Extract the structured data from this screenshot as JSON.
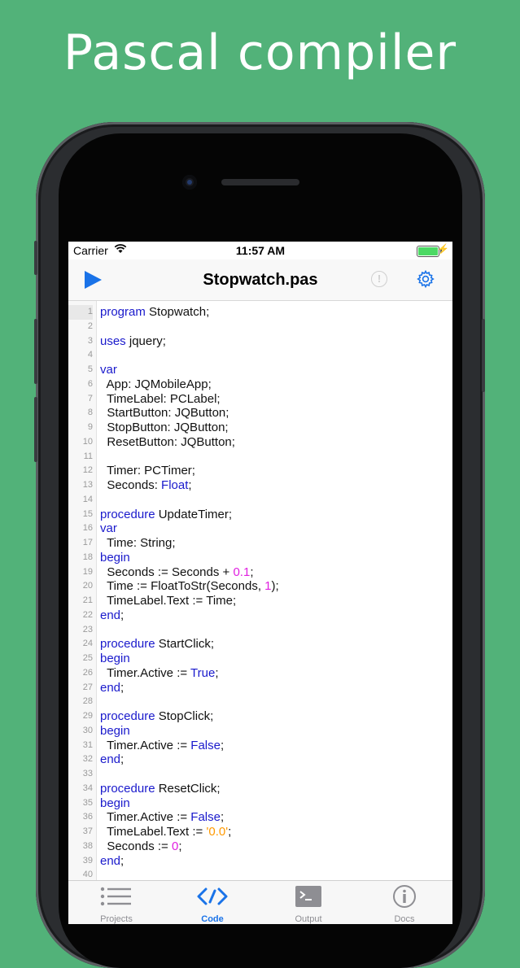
{
  "headline": "Pascal compiler",
  "status": {
    "carrier": "Carrier",
    "time": "11:57 AM"
  },
  "navbar": {
    "title": "Stopwatch.pas"
  },
  "editor": {
    "lines": [
      {
        "n": "1",
        "tokens": [
          {
            "t": "program",
            "c": "kw"
          },
          {
            "t": " Stopwatch;",
            "c": ""
          }
        ]
      },
      {
        "n": "2",
        "tokens": []
      },
      {
        "n": "3",
        "tokens": [
          {
            "t": "uses",
            "c": "kw"
          },
          {
            "t": " jquery;",
            "c": ""
          }
        ]
      },
      {
        "n": "4",
        "tokens": []
      },
      {
        "n": "5",
        "tokens": [
          {
            "t": "var",
            "c": "kw"
          }
        ]
      },
      {
        "n": "6",
        "tokens": [
          {
            "t": "  App: JQMobileApp;",
            "c": ""
          }
        ]
      },
      {
        "n": "7",
        "tokens": [
          {
            "t": "  TimeLabel: PCLabel;",
            "c": ""
          }
        ]
      },
      {
        "n": "8",
        "tokens": [
          {
            "t": "  StartButton: JQButton;",
            "c": ""
          }
        ]
      },
      {
        "n": "9",
        "tokens": [
          {
            "t": "  StopButton: JQButton;",
            "c": ""
          }
        ]
      },
      {
        "n": "10",
        "tokens": [
          {
            "t": "  ResetButton: JQButton;",
            "c": ""
          }
        ]
      },
      {
        "n": "11",
        "tokens": []
      },
      {
        "n": "12",
        "tokens": [
          {
            "t": "  Timer: PCTimer;",
            "c": ""
          }
        ]
      },
      {
        "n": "13",
        "tokens": [
          {
            "t": "  Seconds: ",
            "c": ""
          },
          {
            "t": "Float",
            "c": "kw"
          },
          {
            "t": ";",
            "c": ""
          }
        ]
      },
      {
        "n": "14",
        "tokens": []
      },
      {
        "n": "15",
        "tokens": [
          {
            "t": "procedure",
            "c": "kw"
          },
          {
            "t": " UpdateTimer;",
            "c": ""
          }
        ]
      },
      {
        "n": "16",
        "tokens": [
          {
            "t": "var",
            "c": "kw"
          }
        ]
      },
      {
        "n": "17",
        "tokens": [
          {
            "t": "  Time: String;",
            "c": ""
          }
        ]
      },
      {
        "n": "18",
        "tokens": [
          {
            "t": "begin",
            "c": "kw"
          }
        ]
      },
      {
        "n": "19",
        "tokens": [
          {
            "t": "  Seconds := Seconds + ",
            "c": ""
          },
          {
            "t": "0.1",
            "c": "num"
          },
          {
            "t": ";",
            "c": ""
          }
        ]
      },
      {
        "n": "20",
        "tokens": [
          {
            "t": "  Time := FloatToStr(Seconds, ",
            "c": ""
          },
          {
            "t": "1",
            "c": "num"
          },
          {
            "t": ");",
            "c": ""
          }
        ]
      },
      {
        "n": "21",
        "tokens": [
          {
            "t": "  TimeLabel.Text := Time;",
            "c": ""
          }
        ]
      },
      {
        "n": "22",
        "tokens": [
          {
            "t": "end",
            "c": "kw"
          },
          {
            "t": ";",
            "c": ""
          }
        ]
      },
      {
        "n": "23",
        "tokens": []
      },
      {
        "n": "24",
        "tokens": [
          {
            "t": "procedure",
            "c": "kw"
          },
          {
            "t": " StartClick;",
            "c": ""
          }
        ]
      },
      {
        "n": "25",
        "tokens": [
          {
            "t": "begin",
            "c": "kw"
          }
        ]
      },
      {
        "n": "26",
        "tokens": [
          {
            "t": "  Timer.Active := ",
            "c": ""
          },
          {
            "t": "True",
            "c": "kw"
          },
          {
            "t": ";",
            "c": ""
          }
        ]
      },
      {
        "n": "27",
        "tokens": [
          {
            "t": "end",
            "c": "kw"
          },
          {
            "t": ";",
            "c": ""
          }
        ]
      },
      {
        "n": "28",
        "tokens": []
      },
      {
        "n": "29",
        "tokens": [
          {
            "t": "procedure",
            "c": "kw"
          },
          {
            "t": " StopClick;",
            "c": ""
          }
        ]
      },
      {
        "n": "30",
        "tokens": [
          {
            "t": "begin",
            "c": "kw"
          }
        ]
      },
      {
        "n": "31",
        "tokens": [
          {
            "t": "  Timer.Active := ",
            "c": ""
          },
          {
            "t": "False",
            "c": "kw"
          },
          {
            "t": ";",
            "c": ""
          }
        ]
      },
      {
        "n": "32",
        "tokens": [
          {
            "t": "end",
            "c": "kw"
          },
          {
            "t": ";",
            "c": ""
          }
        ]
      },
      {
        "n": "33",
        "tokens": []
      },
      {
        "n": "34",
        "tokens": [
          {
            "t": "procedure",
            "c": "kw"
          },
          {
            "t": " ResetClick;",
            "c": ""
          }
        ]
      },
      {
        "n": "35",
        "tokens": [
          {
            "t": "begin",
            "c": "kw"
          }
        ]
      },
      {
        "n": "36",
        "tokens": [
          {
            "t": "  Timer.Active := ",
            "c": ""
          },
          {
            "t": "False",
            "c": "kw"
          },
          {
            "t": ";",
            "c": ""
          }
        ]
      },
      {
        "n": "37",
        "tokens": [
          {
            "t": "  TimeLabel.Text := ",
            "c": ""
          },
          {
            "t": "'0.0'",
            "c": "str"
          },
          {
            "t": ";",
            "c": ""
          }
        ]
      },
      {
        "n": "38",
        "tokens": [
          {
            "t": "  Seconds := ",
            "c": ""
          },
          {
            "t": "0",
            "c": "num"
          },
          {
            "t": ";",
            "c": ""
          }
        ]
      },
      {
        "n": "39",
        "tokens": [
          {
            "t": "end",
            "c": "kw"
          },
          {
            "t": ";",
            "c": ""
          }
        ]
      },
      {
        "n": "40",
        "tokens": []
      }
    ]
  },
  "tabs": [
    {
      "label": "Projects",
      "icon": "list-icon",
      "active": false
    },
    {
      "label": "Code",
      "icon": "code-icon",
      "active": true
    },
    {
      "label": "Output",
      "icon": "terminal-icon",
      "active": false
    },
    {
      "label": "Docs",
      "icon": "info-icon",
      "active": false
    }
  ],
  "colors": {
    "background": "#52b279",
    "accent": "#1a73e8",
    "keyword": "#1a1acc",
    "number": "#e020e0",
    "string": "#ff9900"
  }
}
